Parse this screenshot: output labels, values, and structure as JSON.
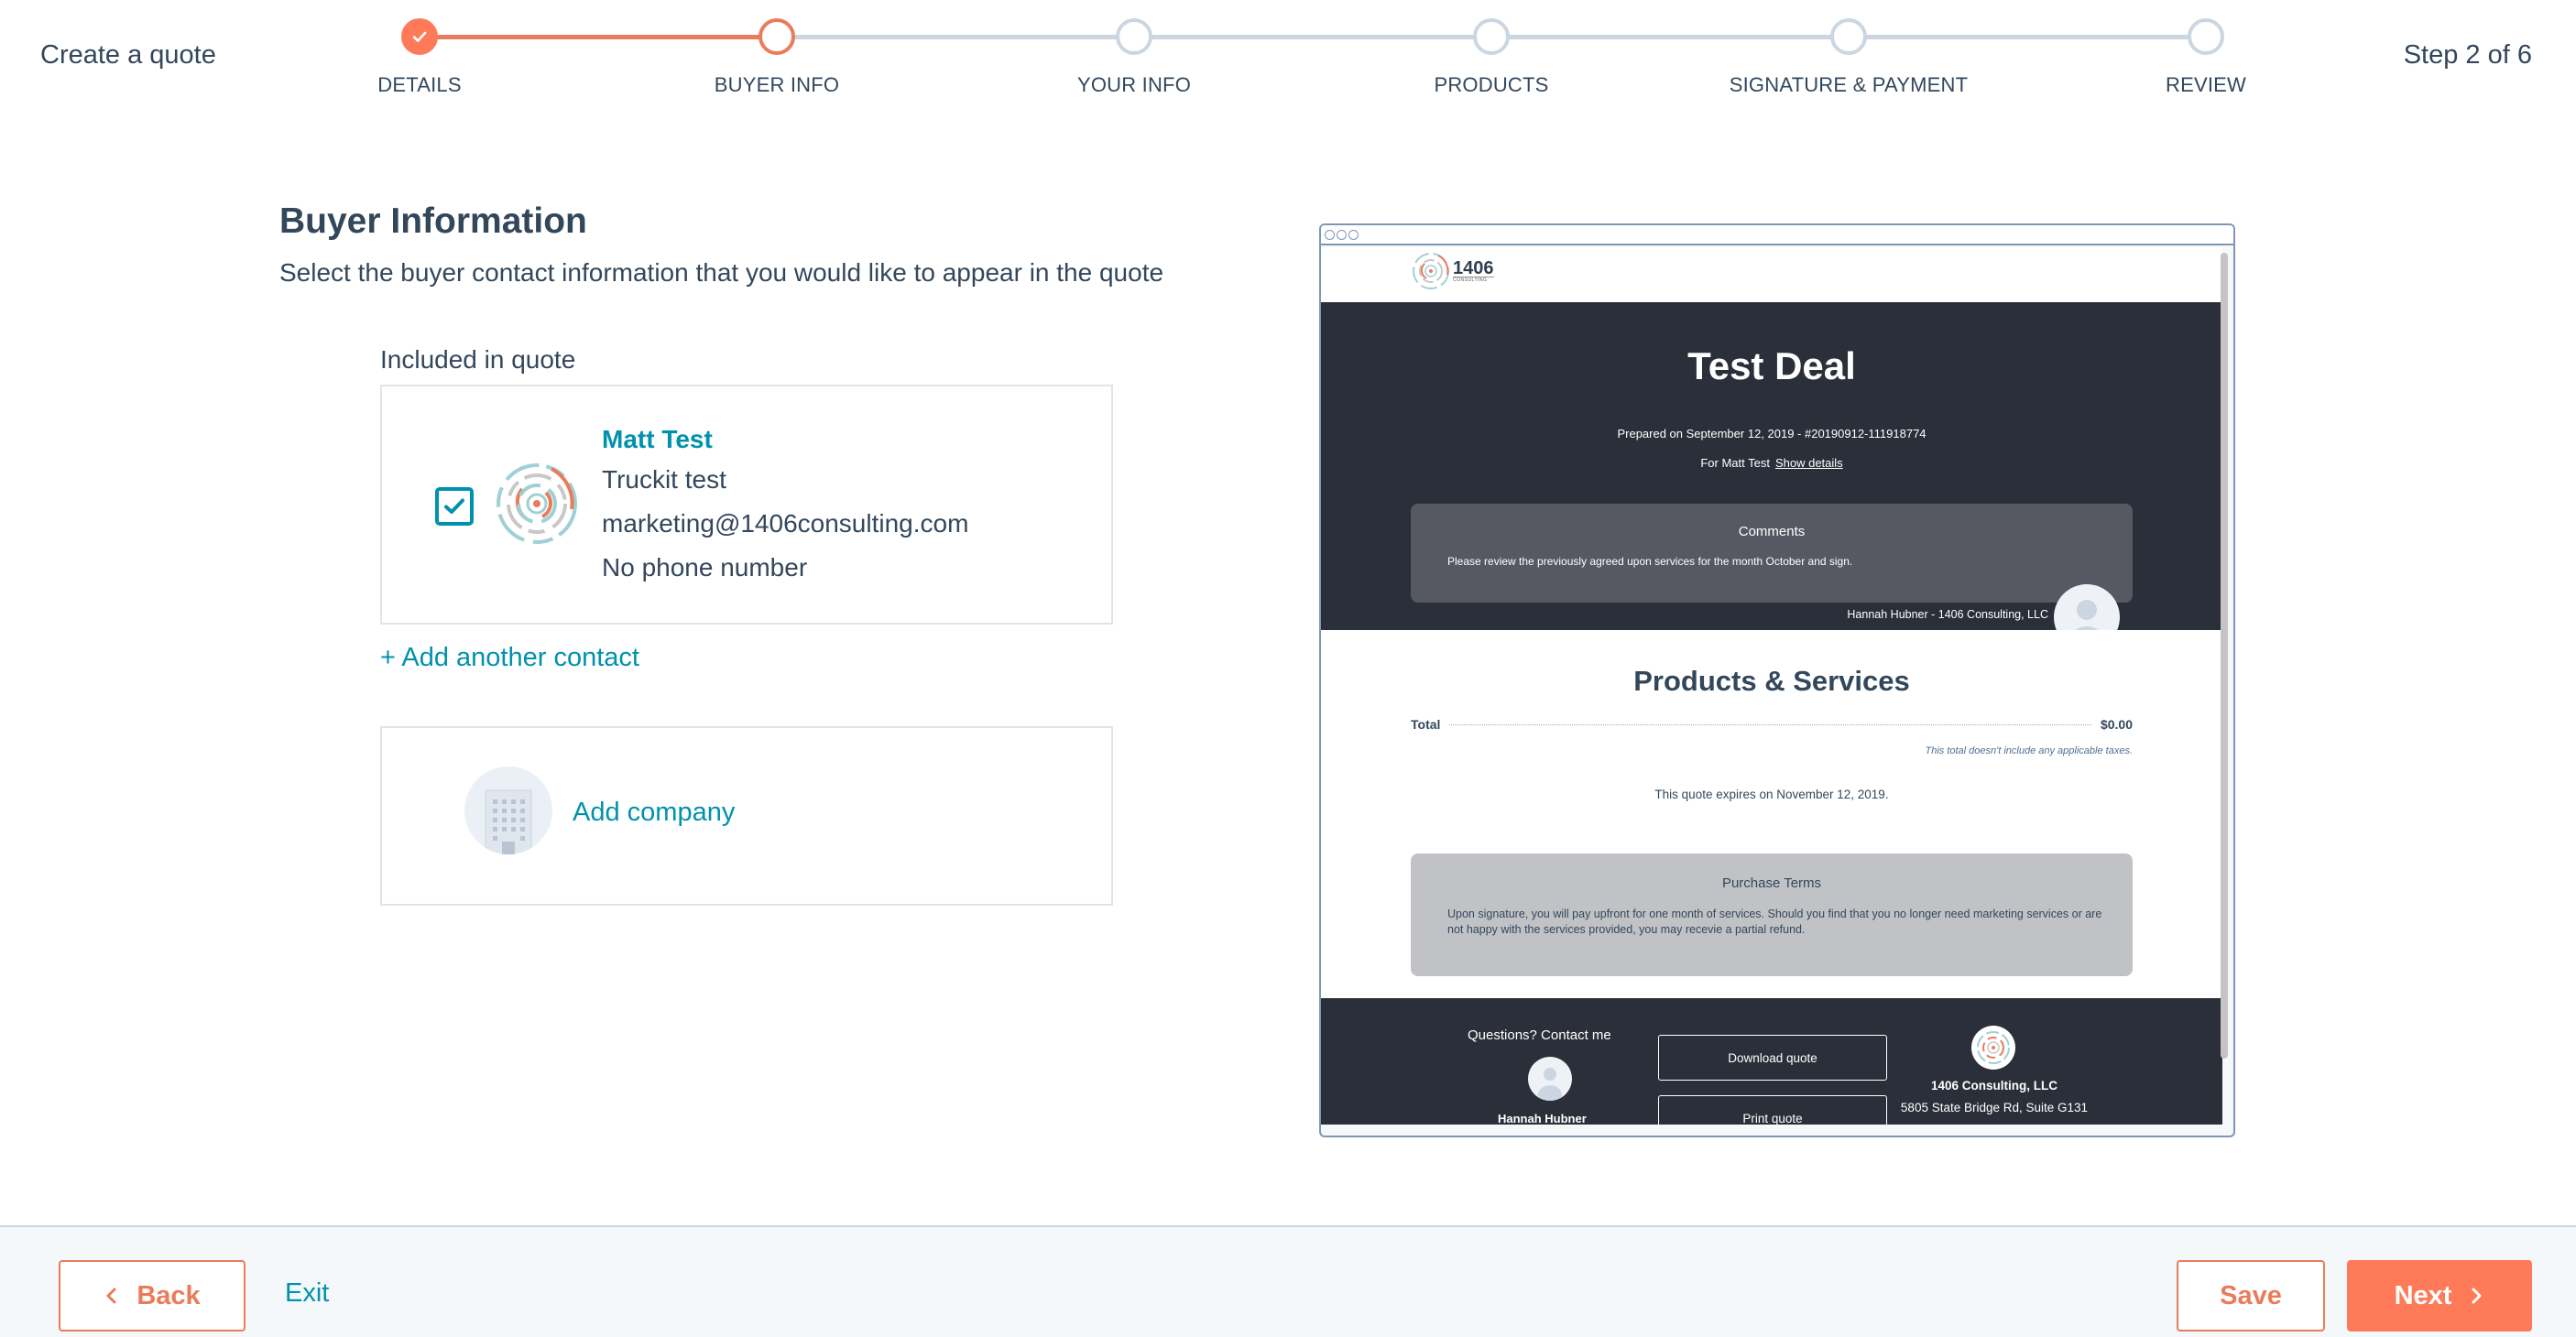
{
  "header": {
    "title": "Create a quote",
    "step_count": "Step 2 of 6",
    "steps": [
      {
        "label": "DETAILS",
        "state": "complete"
      },
      {
        "label": "BUYER INFO",
        "state": "active"
      },
      {
        "label": "YOUR INFO",
        "state": "pending"
      },
      {
        "label": "PRODUCTS",
        "state": "pending"
      },
      {
        "label": "SIGNATURE & PAYMENT",
        "state": "pending"
      },
      {
        "label": "REVIEW",
        "state": "pending"
      }
    ]
  },
  "buyer": {
    "title": "Buyer Information",
    "subtitle": "Select the buyer contact information that you would like to appear in the quote",
    "included_label": "Included in quote",
    "contact": {
      "checked": true,
      "name": "Matt Test",
      "company": "Truckit test",
      "email": "marketing@1406consulting.com",
      "phone": "No phone number"
    },
    "add_contact_label": "+ Add another contact",
    "add_company_label": "Add company"
  },
  "preview": {
    "logo_text": "1406",
    "logo_sub": "CONSULTING",
    "title": "Test Deal",
    "prepared": "Prepared on September 12, 2019 - #20190912-111918774",
    "for_label": "For Matt Test",
    "show_details": "Show details",
    "comments_title": "Comments",
    "comments_text": "Please review the previously agreed upon services for the month October and sign.",
    "signer": "Hannah Hubner - 1406 Consulting, LLC",
    "products_title": "Products & Services",
    "total_label": "Total",
    "total_value": "$0.00",
    "tax_note": "This total doesn't include any applicable taxes.",
    "expires": "This quote expires on November 12, 2019.",
    "terms_title": "Purchase Terms",
    "terms_text": "Upon signature, you will pay upfront for one month of services. Should you find that you no longer need marketing services or are not happy with the services provided, you may recevie a partial refund.",
    "questions": "Questions? Contact me",
    "host_name": "Hannah Hubner",
    "download_label": "Download quote",
    "print_label": "Print quote",
    "company_name": "1406 Consulting, LLC",
    "company_address": "5805 State Bridge Rd, Suite G131"
  },
  "footer": {
    "back_label": "Back",
    "exit_label": "Exit",
    "save_label": "Save",
    "next_label": "Next"
  },
  "colors": {
    "accent_orange": "#ff7a59",
    "accent_orange_border": "#ea7b5b",
    "link_teal": "#0091ae",
    "text_dark": "#33475b",
    "step_inactive": "#cbd6e2",
    "preview_dark": "#2b2f3a"
  }
}
